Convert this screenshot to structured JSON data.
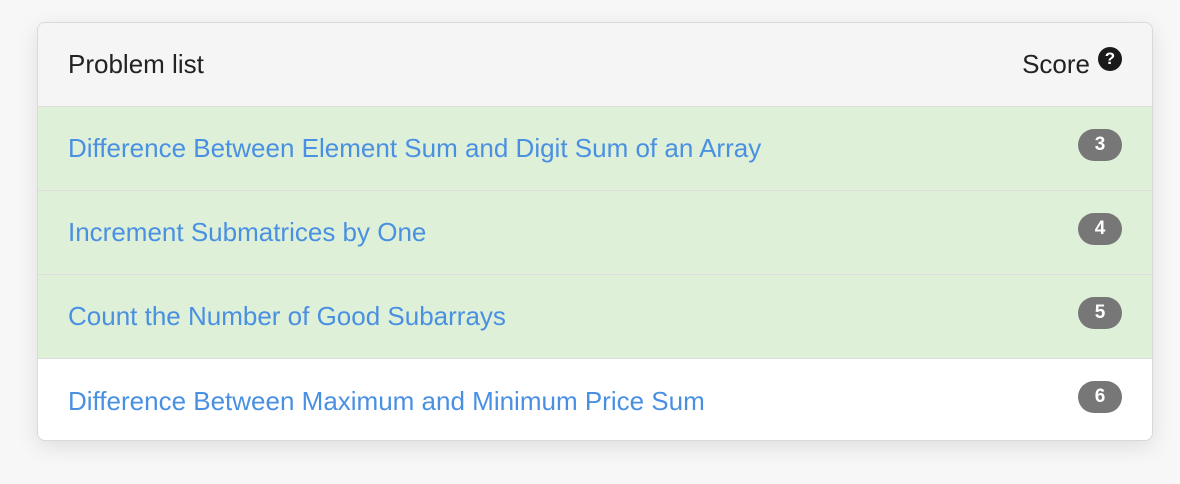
{
  "header": {
    "title": "Problem list",
    "score_label": "Score",
    "help_icon_glyph": "?"
  },
  "colors": {
    "solved_row": "#dff0d8",
    "link": "#4a90e2",
    "badge": "#777777"
  },
  "problems": [
    {
      "title": "Difference Between Element Sum and Digit Sum of an Array",
      "score": "3",
      "solved": true
    },
    {
      "title": "Increment Submatrices by One",
      "score": "4",
      "solved": true
    },
    {
      "title": "Count the Number of Good Subarrays",
      "score": "5",
      "solved": true
    },
    {
      "title": "Difference Between Maximum and Minimum Price Sum",
      "score": "6",
      "solved": false
    }
  ]
}
